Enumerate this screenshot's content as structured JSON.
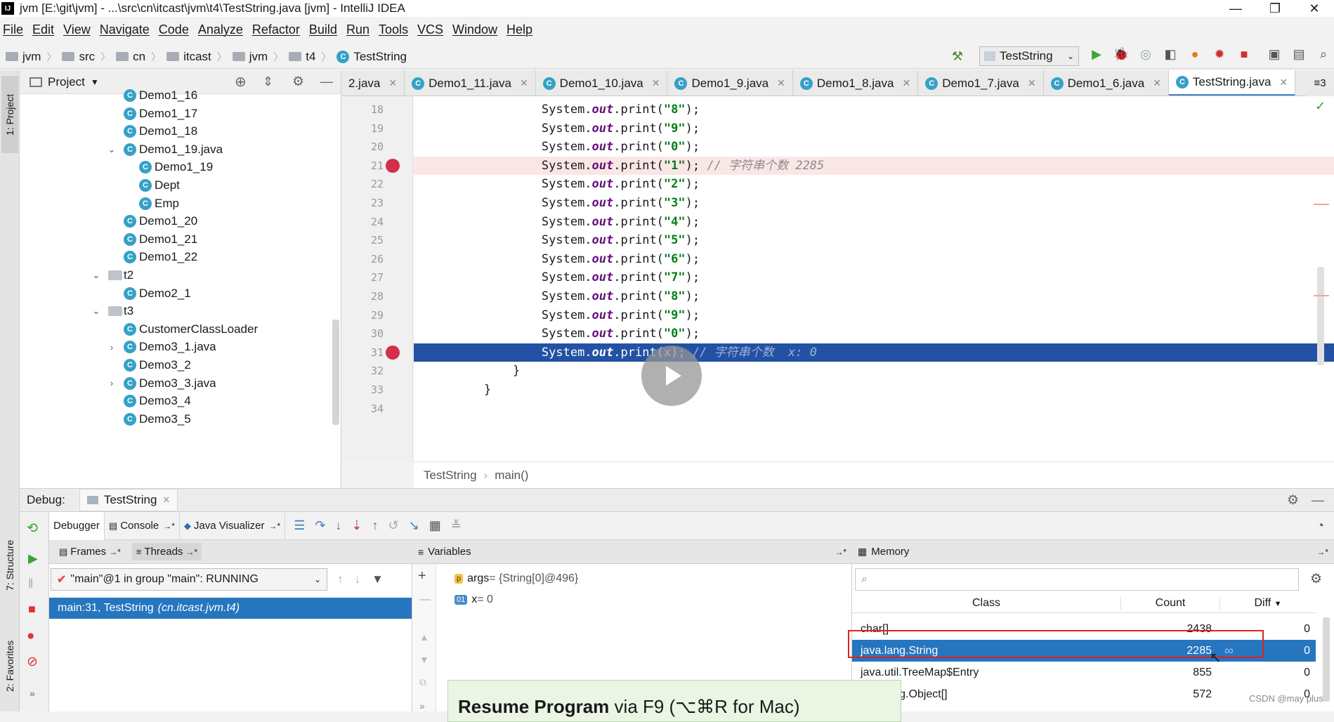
{
  "window": {
    "title": "jvm [E:\\git\\jvm] - ...\\src\\cn\\itcast\\jvm\\t4\\TestString.java [jvm] - IntelliJ IDEA",
    "minimize": "—",
    "restore": "❐",
    "close": "✕"
  },
  "menu": [
    "File",
    "Edit",
    "View",
    "Navigate",
    "Code",
    "Analyze",
    "Refactor",
    "Build",
    "Run",
    "Tools",
    "VCS",
    "Window",
    "Help"
  ],
  "breadcrumb": [
    "jvm",
    "src",
    "cn",
    "itcast",
    "jvm",
    "t4",
    "TestString"
  ],
  "run_config": "TestString",
  "left_strip": {
    "project": "1: Project",
    "structure": "7: Structure",
    "favorites": "2: Favorites"
  },
  "project": {
    "header": "Project",
    "items": [
      {
        "label": "Demo1_16",
        "depth": 3,
        "icon": "class",
        "arrow": ""
      },
      {
        "label": "Demo1_17",
        "depth": 3,
        "icon": "class",
        "arrow": ""
      },
      {
        "label": "Demo1_18",
        "depth": 3,
        "icon": "class",
        "arrow": ""
      },
      {
        "label": "Demo1_19.java",
        "depth": 3,
        "icon": "class",
        "arrow": "⌄"
      },
      {
        "label": "Demo1_19",
        "depth": 4,
        "icon": "class",
        "arrow": ""
      },
      {
        "label": "Dept",
        "depth": 4,
        "icon": "class",
        "arrow": ""
      },
      {
        "label": "Emp",
        "depth": 4,
        "icon": "class",
        "arrow": ""
      },
      {
        "label": "Demo1_20",
        "depth": 3,
        "icon": "class",
        "arrow": ""
      },
      {
        "label": "Demo1_21",
        "depth": 3,
        "icon": "class",
        "arrow": ""
      },
      {
        "label": "Demo1_22",
        "depth": 3,
        "icon": "class",
        "arrow": ""
      },
      {
        "label": "t2",
        "depth": 2,
        "icon": "package",
        "arrow": "⌄"
      },
      {
        "label": "Demo2_1",
        "depth": 3,
        "icon": "class",
        "arrow": ""
      },
      {
        "label": "t3",
        "depth": 2,
        "icon": "package",
        "arrow": "⌄"
      },
      {
        "label": "CustomerClassLoader",
        "depth": 3,
        "icon": "class",
        "arrow": ""
      },
      {
        "label": "Demo3_1.java",
        "depth": 3,
        "icon": "class",
        "arrow": "›"
      },
      {
        "label": "Demo3_2",
        "depth": 3,
        "icon": "class",
        "arrow": ""
      },
      {
        "label": "Demo3_3.java",
        "depth": 3,
        "icon": "class",
        "arrow": "›"
      },
      {
        "label": "Demo3_4",
        "depth": 3,
        "icon": "class",
        "arrow": ""
      },
      {
        "label": "Demo3_5",
        "depth": 3,
        "icon": "class",
        "arrow": ""
      }
    ]
  },
  "editor_tabs": [
    {
      "label": "2.java",
      "active": false,
      "icon": false
    },
    {
      "label": "Demo1_11.java",
      "active": false,
      "icon": true
    },
    {
      "label": "Demo1_10.java",
      "active": false,
      "icon": true
    },
    {
      "label": "Demo1_9.java",
      "active": false,
      "icon": true
    },
    {
      "label": "Demo1_8.java",
      "active": false,
      "icon": true
    },
    {
      "label": "Demo1_7.java",
      "active": false,
      "icon": true
    },
    {
      "label": "Demo1_6.java",
      "active": false,
      "icon": true
    },
    {
      "label": "TestString.java",
      "active": true,
      "icon": true
    }
  ],
  "tab_overflow": "≡3",
  "code_lines": [
    {
      "n": "18",
      "indent": "        ",
      "sys": "System.",
      "out": "out",
      "mid": ".print(",
      "str": "\"8\"",
      "end": ");",
      "comment": "",
      "state": ""
    },
    {
      "n": "19",
      "indent": "        ",
      "sys": "System.",
      "out": "out",
      "mid": ".print(",
      "str": "\"9\"",
      "end": ");",
      "comment": "",
      "state": ""
    },
    {
      "n": "20",
      "indent": "        ",
      "sys": "System.",
      "out": "out",
      "mid": ".print(",
      "str": "\"0\"",
      "end": ");",
      "comment": "",
      "state": ""
    },
    {
      "n": "21",
      "indent": "        ",
      "sys": "System.",
      "out": "out",
      "mid": ".print(",
      "str": "\"1\"",
      "end": ");",
      "comment": " // 字符串个数 2285",
      "state": "hit"
    },
    {
      "n": "22",
      "indent": "        ",
      "sys": "System.",
      "out": "out",
      "mid": ".print(",
      "str": "\"2\"",
      "end": ");",
      "comment": "",
      "state": ""
    },
    {
      "n": "23",
      "indent": "        ",
      "sys": "System.",
      "out": "out",
      "mid": ".print(",
      "str": "\"3\"",
      "end": ");",
      "comment": "",
      "state": ""
    },
    {
      "n": "24",
      "indent": "        ",
      "sys": "System.",
      "out": "out",
      "mid": ".print(",
      "str": "\"4\"",
      "end": ");",
      "comment": "",
      "state": ""
    },
    {
      "n": "25",
      "indent": "        ",
      "sys": "System.",
      "out": "out",
      "mid": ".print(",
      "str": "\"5\"",
      "end": ");",
      "comment": "",
      "state": ""
    },
    {
      "n": "26",
      "indent": "        ",
      "sys": "System.",
      "out": "out",
      "mid": ".print(",
      "str": "\"6\"",
      "end": ");",
      "comment": "",
      "state": ""
    },
    {
      "n": "27",
      "indent": "        ",
      "sys": "System.",
      "out": "out",
      "mid": ".print(",
      "str": "\"7\"",
      "end": ");",
      "comment": "",
      "state": ""
    },
    {
      "n": "28",
      "indent": "        ",
      "sys": "System.",
      "out": "out",
      "mid": ".print(",
      "str": "\"8\"",
      "end": ");",
      "comment": "",
      "state": ""
    },
    {
      "n": "29",
      "indent": "        ",
      "sys": "System.",
      "out": "out",
      "mid": ".print(",
      "str": "\"9\"",
      "end": ");",
      "comment": "",
      "state": ""
    },
    {
      "n": "30",
      "indent": "        ",
      "sys": "System.",
      "out": "out",
      "mid": ".print(",
      "str": "\"0\"",
      "end": ");",
      "comment": "",
      "state": ""
    },
    {
      "n": "31",
      "indent": "        ",
      "sys": "System.",
      "out": "out",
      "mid": ".print(x);",
      "str": "",
      "end": "",
      "comment": " // 字符串个数  x: 0",
      "state": "cur"
    },
    {
      "n": "32",
      "indent": "    ",
      "sys": "}",
      "out": "",
      "mid": "",
      "str": "",
      "end": "",
      "comment": "",
      "state": ""
    },
    {
      "n": "33",
      "indent": "",
      "sys": "}",
      "out": "",
      "mid": "",
      "str": "",
      "end": "",
      "comment": "",
      "state": ""
    },
    {
      "n": "34",
      "indent": "",
      "sys": "",
      "out": "",
      "mid": "",
      "str": "",
      "end": "",
      "comment": "",
      "state": ""
    }
  ],
  "editor_breadcrumb": {
    "cls": "TestString",
    "method": "main()"
  },
  "debug": {
    "label": "Debug:",
    "session": "TestString",
    "tabs": {
      "debugger": "Debugger",
      "console": "Console",
      "visualizer": "Java Visualizer"
    },
    "frames_tab": "Frames",
    "threads_tab": "Threads",
    "thread_select": "\"main\"@1 in group \"main\": RUNNING",
    "frame_row": {
      "loc": "main:31, TestString",
      "pkg": "(cn.itcast.jvm.t4)"
    },
    "variables_header": "Variables",
    "variables": [
      {
        "icon": "p",
        "name": "args",
        "value": " = {String[0]@496}"
      },
      {
        "icon": "01",
        "name": "x",
        "value": " = 0"
      }
    ],
    "memory_header": "Memory",
    "memory_cols": {
      "cls": "Class",
      "count": "Count",
      "diff": "Diff"
    },
    "memory_rows": [
      {
        "cls": "char[]",
        "count": "2438",
        "diff": "0",
        "sel": false
      },
      {
        "cls": "java.lang.String",
        "count": "2285",
        "diff": "0",
        "sel": true
      },
      {
        "cls": "java.util.TreeMap$Entry",
        "count": "855",
        "diff": "0",
        "sel": false
      },
      {
        "cls": "java.lang.Object[]",
        "count": "572",
        "diff": "0",
        "sel": false
      }
    ]
  },
  "tooltip": {
    "bold": "Resume Program",
    "rest": " via F9 (⌥⌘R for Mac)"
  },
  "watermark": "CSDN @may plus",
  "colors": {
    "accent": "#2675bf",
    "current_line": "#2351a4",
    "breakpoint": "#d32f4a"
  }
}
